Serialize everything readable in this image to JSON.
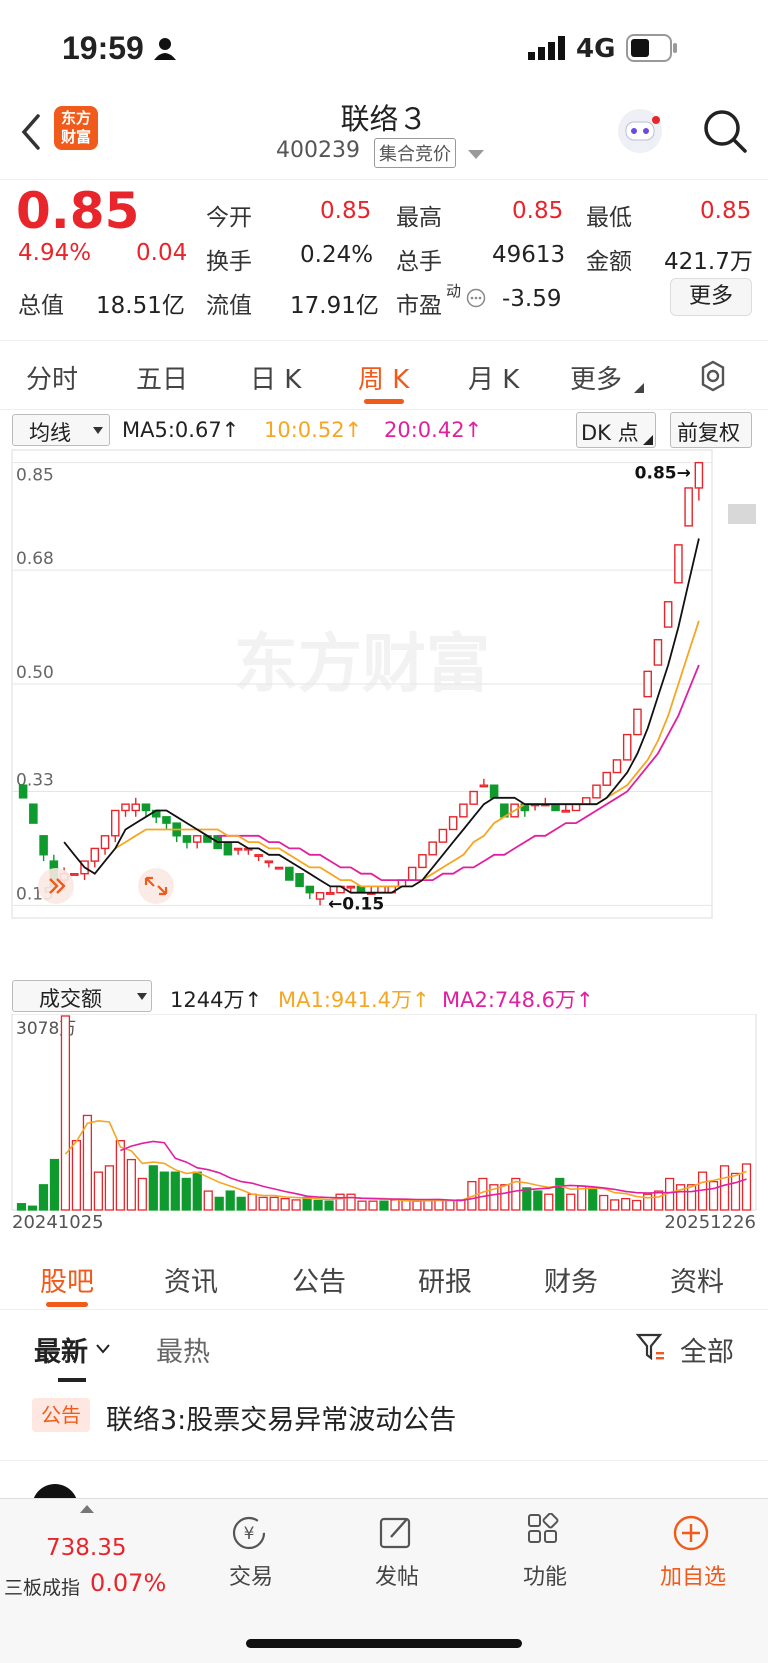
{
  "status": {
    "time": "19:59",
    "network": "4G"
  },
  "nav": {
    "logo_line1": "东方",
    "logo_line2": "财富",
    "title": "联络３",
    "code": "400239",
    "badge": "集合竞价"
  },
  "quote": {
    "price": "0.85",
    "pct": "4.94%",
    "change": "0.04",
    "rows": [
      [
        {
          "label": "今开",
          "value": "0.85"
        },
        {
          "label": "最高",
          "value": "0.85"
        },
        {
          "label": "最低",
          "value": "0.85"
        }
      ],
      [
        {
          "label": "换手",
          "value": "0.24%"
        },
        {
          "label": "总手",
          "value": "49613"
        },
        {
          "label": "金额",
          "value": "421.7万"
        }
      ],
      [
        {
          "label": "流值",
          "value": "17.91亿"
        },
        {
          "label": "市盈",
          "value": "-3.59"
        }
      ]
    ],
    "total_value_label": "总值",
    "total_value": "18.51亿",
    "pe_sup": "动",
    "more": "更多"
  },
  "tabs": [
    "分时",
    "五日",
    "日 K",
    "周 K",
    "月 K",
    "更多"
  ],
  "active_tab": "周 K",
  "ma": {
    "select": "均线",
    "ma5": "MA5:0.67↑",
    "ma10": "10:0.52↑",
    "ma20": "20:0.42↑",
    "dk": "DK 点",
    "fq": "前复权"
  },
  "vol": {
    "select": "成交额",
    "value": "1244万↑",
    "ma1": "MA1:941.4万↑",
    "ma2": "MA2:748.6万↑",
    "max_label": "3078万"
  },
  "watermark": "东方财富",
  "colors": {
    "up": "#e8252b",
    "down": "#0f9a2e",
    "ma5": "#111111",
    "ma10": "#f5a623",
    "ma20": "#e020a0",
    "accent": "#f05a1a"
  },
  "chart_data": {
    "type": "candlestick",
    "y_ticks": [
      "0.85",
      "0.68",
      "0.50",
      "0.33",
      "0.15"
    ],
    "ylim": [
      0.13,
      0.87
    ],
    "high_label": "0.85→",
    "low_label": "←0.15",
    "x_start": "20241025",
    "x_end": "20251226",
    "candles": [
      {
        "o": 0.34,
        "c": 0.32,
        "h": 0.34,
        "l": 0.32
      },
      {
        "o": 0.31,
        "c": 0.28,
        "h": 0.31,
        "l": 0.28
      },
      {
        "o": 0.26,
        "c": 0.23,
        "h": 0.26,
        "l": 0.22
      },
      {
        "o": 0.22,
        "c": 0.18,
        "h": 0.23,
        "l": 0.17
      },
      {
        "o": 0.19,
        "c": 0.2,
        "h": 0.21,
        "l": 0.18
      },
      {
        "o": 0.2,
        "c": 0.2,
        "h": 0.2,
        "l": 0.2
      },
      {
        "o": 0.2,
        "c": 0.22,
        "h": 0.22,
        "l": 0.19
      },
      {
        "o": 0.22,
        "c": 0.24,
        "h": 0.24,
        "l": 0.21
      },
      {
        "o": 0.24,
        "c": 0.26,
        "h": 0.26,
        "l": 0.23
      },
      {
        "o": 0.26,
        "c": 0.3,
        "h": 0.3,
        "l": 0.25
      },
      {
        "o": 0.3,
        "c": 0.31,
        "h": 0.31,
        "l": 0.29
      },
      {
        "o": 0.3,
        "c": 0.31,
        "h": 0.32,
        "l": 0.29
      },
      {
        "o": 0.31,
        "c": 0.3,
        "h": 0.31,
        "l": 0.29
      },
      {
        "o": 0.3,
        "c": 0.29,
        "h": 0.3,
        "l": 0.28
      },
      {
        "o": 0.29,
        "c": 0.28,
        "h": 0.29,
        "l": 0.27
      },
      {
        "o": 0.28,
        "c": 0.26,
        "h": 0.28,
        "l": 0.25
      },
      {
        "o": 0.26,
        "c": 0.25,
        "h": 0.26,
        "l": 0.24
      },
      {
        "o": 0.25,
        "c": 0.26,
        "h": 0.26,
        "l": 0.24
      },
      {
        "o": 0.26,
        "c": 0.25,
        "h": 0.26,
        "l": 0.25
      },
      {
        "o": 0.26,
        "c": 0.24,
        "h": 0.26,
        "l": 0.24
      },
      {
        "o": 0.25,
        "c": 0.23,
        "h": 0.25,
        "l": 0.23
      },
      {
        "o": 0.24,
        "c": 0.24,
        "h": 0.24,
        "l": 0.23
      },
      {
        "o": 0.24,
        "c": 0.24,
        "h": 0.24,
        "l": 0.23
      },
      {
        "o": 0.23,
        "c": 0.23,
        "h": 0.23,
        "l": 0.22
      },
      {
        "o": 0.22,
        "c": 0.22,
        "h": 0.22,
        "l": 0.21
      },
      {
        "o": 0.21,
        "c": 0.21,
        "h": 0.21,
        "l": 0.21
      },
      {
        "o": 0.21,
        "c": 0.19,
        "h": 0.21,
        "l": 0.19
      },
      {
        "o": 0.2,
        "c": 0.18,
        "h": 0.2,
        "l": 0.18
      },
      {
        "o": 0.18,
        "c": 0.17,
        "h": 0.18,
        "l": 0.16
      },
      {
        "o": 0.16,
        "c": 0.17,
        "h": 0.17,
        "l": 0.15
      },
      {
        "o": 0.17,
        "c": 0.17,
        "h": 0.18,
        "l": 0.17
      },
      {
        "o": 0.17,
        "c": 0.18,
        "h": 0.18,
        "l": 0.17
      },
      {
        "o": 0.18,
        "c": 0.18,
        "h": 0.18,
        "l": 0.17
      },
      {
        "o": 0.18,
        "c": 0.17,
        "h": 0.18,
        "l": 0.17
      },
      {
        "o": 0.17,
        "c": 0.17,
        "h": 0.18,
        "l": 0.17
      },
      {
        "o": 0.17,
        "c": 0.18,
        "h": 0.18,
        "l": 0.17
      },
      {
        "o": 0.17,
        "c": 0.18,
        "h": 0.18,
        "l": 0.17
      },
      {
        "o": 0.18,
        "c": 0.19,
        "h": 0.19,
        "l": 0.18
      },
      {
        "o": 0.19,
        "c": 0.21,
        "h": 0.21,
        "l": 0.19
      },
      {
        "o": 0.21,
        "c": 0.23,
        "h": 0.23,
        "l": 0.21
      },
      {
        "o": 0.23,
        "c": 0.25,
        "h": 0.25,
        "l": 0.23
      },
      {
        "o": 0.25,
        "c": 0.27,
        "h": 0.27,
        "l": 0.25
      },
      {
        "o": 0.27,
        "c": 0.29,
        "h": 0.29,
        "l": 0.27
      },
      {
        "o": 0.29,
        "c": 0.31,
        "h": 0.31,
        "l": 0.29
      },
      {
        "o": 0.31,
        "c": 0.33,
        "h": 0.33,
        "l": 0.31
      },
      {
        "o": 0.34,
        "c": 0.34,
        "h": 0.35,
        "l": 0.34
      },
      {
        "o": 0.34,
        "c": 0.32,
        "h": 0.34,
        "l": 0.32
      },
      {
        "o": 0.31,
        "c": 0.29,
        "h": 0.31,
        "l": 0.29
      },
      {
        "o": 0.29,
        "c": 0.31,
        "h": 0.31,
        "l": 0.29
      },
      {
        "o": 0.31,
        "c": 0.3,
        "h": 0.31,
        "l": 0.29
      },
      {
        "o": 0.31,
        "c": 0.31,
        "h": 0.31,
        "l": 0.3
      },
      {
        "o": 0.31,
        "c": 0.31,
        "h": 0.32,
        "l": 0.31
      },
      {
        "o": 0.31,
        "c": 0.3,
        "h": 0.31,
        "l": 0.3
      },
      {
        "o": 0.3,
        "c": 0.3,
        "h": 0.31,
        "l": 0.3
      },
      {
        "o": 0.3,
        "c": 0.31,
        "h": 0.31,
        "l": 0.3
      },
      {
        "o": 0.31,
        "c": 0.32,
        "h": 0.32,
        "l": 0.31
      },
      {
        "o": 0.32,
        "c": 0.34,
        "h": 0.34,
        "l": 0.32
      },
      {
        "o": 0.34,
        "c": 0.36,
        "h": 0.36,
        "l": 0.34
      },
      {
        "o": 0.36,
        "c": 0.38,
        "h": 0.38,
        "l": 0.36
      },
      {
        "o": 0.38,
        "c": 0.42,
        "h": 0.42,
        "l": 0.38
      },
      {
        "o": 0.42,
        "c": 0.46,
        "h": 0.46,
        "l": 0.42
      },
      {
        "o": 0.48,
        "c": 0.52,
        "h": 0.52,
        "l": 0.48
      },
      {
        "o": 0.53,
        "c": 0.57,
        "h": 0.57,
        "l": 0.53
      },
      {
        "o": 0.59,
        "c": 0.63,
        "h": 0.63,
        "l": 0.59
      },
      {
        "o": 0.66,
        "c": 0.72,
        "h": 0.72,
        "l": 0.66
      },
      {
        "o": 0.75,
        "c": 0.81,
        "h": 0.81,
        "l": 0.75
      },
      {
        "o": 0.81,
        "c": 0.85,
        "h": 0.85,
        "l": 0.79
      }
    ],
    "ma5": [
      null,
      null,
      null,
      null,
      0.25,
      0.23,
      0.21,
      0.2,
      0.22,
      0.24,
      0.27,
      0.28,
      0.29,
      0.3,
      0.3,
      0.29,
      0.28,
      0.27,
      0.26,
      0.25,
      0.25,
      0.25,
      0.24,
      0.24,
      0.23,
      0.23,
      0.22,
      0.21,
      0.2,
      0.19,
      0.18,
      0.18,
      0.17,
      0.17,
      0.17,
      0.17,
      0.17,
      0.18,
      0.18,
      0.19,
      0.21,
      0.23,
      0.25,
      0.27,
      0.29,
      0.31,
      0.32,
      0.32,
      0.32,
      0.31,
      0.31,
      0.31,
      0.31,
      0.31,
      0.31,
      0.31,
      0.31,
      0.32,
      0.34,
      0.36,
      0.39,
      0.43,
      0.48,
      0.53,
      0.59,
      0.66,
      0.73
    ],
    "ma10": [
      null,
      null,
      null,
      null,
      null,
      null,
      null,
      null,
      null,
      0.24,
      0.25,
      0.26,
      0.27,
      0.27,
      0.27,
      0.27,
      0.27,
      0.27,
      0.27,
      0.27,
      0.26,
      0.26,
      0.25,
      0.25,
      0.24,
      0.24,
      0.23,
      0.22,
      0.21,
      0.21,
      0.2,
      0.19,
      0.19,
      0.18,
      0.18,
      0.18,
      0.18,
      0.18,
      0.18,
      0.19,
      0.2,
      0.21,
      0.22,
      0.23,
      0.25,
      0.26,
      0.28,
      0.29,
      0.3,
      0.31,
      0.31,
      0.31,
      0.31,
      0.31,
      0.31,
      0.31,
      0.31,
      0.32,
      0.33,
      0.34,
      0.36,
      0.38,
      0.41,
      0.45,
      0.5,
      0.55,
      0.6
    ],
    "ma20": [
      null,
      null,
      null,
      null,
      null,
      null,
      null,
      null,
      null,
      null,
      null,
      null,
      null,
      null,
      null,
      null,
      null,
      null,
      null,
      0.26,
      0.26,
      0.26,
      0.26,
      0.26,
      0.25,
      0.25,
      0.24,
      0.24,
      0.23,
      0.23,
      0.22,
      0.21,
      0.21,
      0.2,
      0.2,
      0.19,
      0.19,
      0.19,
      0.19,
      0.19,
      0.19,
      0.2,
      0.2,
      0.21,
      0.21,
      0.22,
      0.23,
      0.23,
      0.24,
      0.25,
      0.26,
      0.26,
      0.27,
      0.28,
      0.28,
      0.29,
      0.3,
      0.31,
      0.32,
      0.33,
      0.35,
      0.37,
      0.39,
      0.42,
      0.45,
      0.49,
      0.53
    ],
    "volume": [
      1,
      0.6,
      4,
      8,
      30.78,
      11,
      15,
      6,
      7,
      11,
      8,
      5,
      7,
      6,
      6,
      5,
      6,
      3,
      2,
      3,
      2,
      2.5,
      2,
      2,
      1.8,
      1.6,
      2,
      1.5,
      1.4,
      2.5,
      2.5,
      1.4,
      1.4,
      1.4,
      1.6,
      1.5,
      1.4,
      1.5,
      1.6,
      1.5,
      1.6,
      4.5,
      5,
      4,
      4,
      5,
      3.5,
      3,
      2.5,
      5,
      2.5,
      3.8,
      3.5,
      2.3,
      1.6,
      1.8,
      1.5,
      2.5,
      3,
      5,
      4,
      4,
      6,
      4.5,
      7,
      5.8,
      7.3
    ]
  },
  "feed": {
    "tabs": [
      "股吧",
      "资讯",
      "公告",
      "研报",
      "财务",
      "资料"
    ],
    "sort_new": "最新",
    "sort_hot": "最热",
    "filter": "全部",
    "notice_tag": "公告",
    "notice_title": "联络3:股票交易异常波动公告"
  },
  "bottom": {
    "index_value": "738.35",
    "index_name": "三板成指",
    "index_pct": "0.07%",
    "trade": "交易",
    "post": "发帖",
    "func": "功能",
    "add": "加自选"
  }
}
